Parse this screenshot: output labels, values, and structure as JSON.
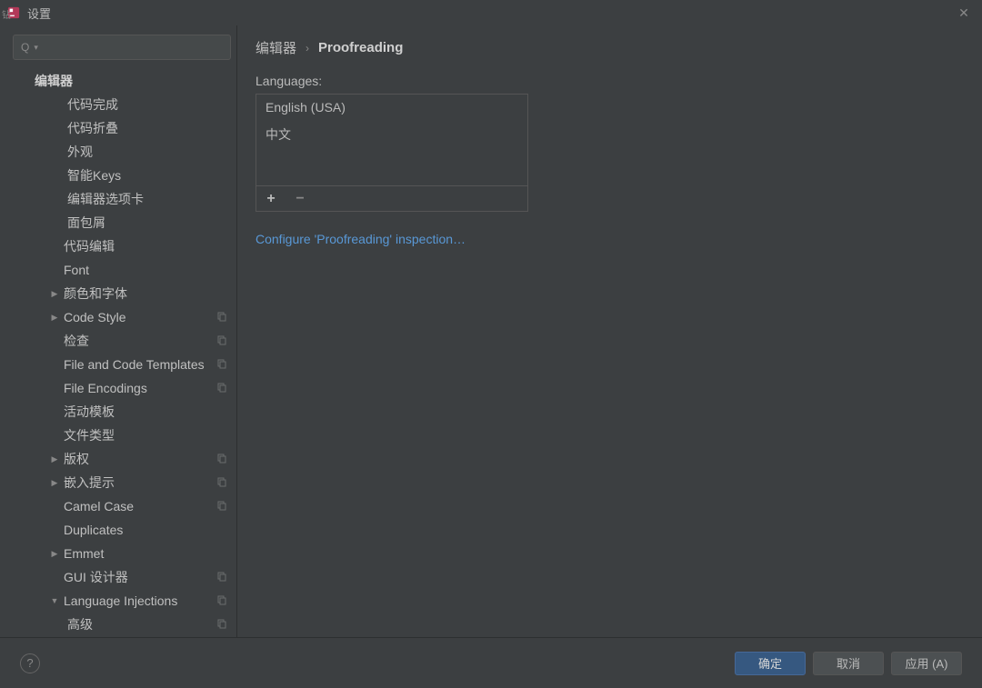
{
  "title": "设置",
  "search": {
    "placeholder": ""
  },
  "sidebar": {
    "section": "编辑器",
    "items": [
      {
        "label": "代码完成",
        "indent": 2,
        "arrow": "",
        "copy": false
      },
      {
        "label": "代码折叠",
        "indent": 2,
        "arrow": "",
        "copy": false
      },
      {
        "label": "外观",
        "indent": 2,
        "arrow": "",
        "copy": false
      },
      {
        "label": "智能Keys",
        "indent": 2,
        "arrow": "▶",
        "copy": false
      },
      {
        "label": "编辑器选项卡",
        "indent": 2,
        "arrow": "",
        "copy": false
      },
      {
        "label": "面包屑",
        "indent": 2,
        "arrow": "",
        "copy": false
      },
      {
        "label": "代码编辑",
        "indent": 1,
        "arrow": "",
        "copy": false
      },
      {
        "label": "Font",
        "indent": 1,
        "arrow": "",
        "copy": false
      },
      {
        "label": "颜色和字体",
        "indent": 1,
        "arrow": "▶",
        "copy": false
      },
      {
        "label": "Code Style",
        "indent": 1,
        "arrow": "▶",
        "copy": true
      },
      {
        "label": "检查",
        "indent": 1,
        "arrow": "",
        "copy": true
      },
      {
        "label": "File and Code Templates",
        "indent": 1,
        "arrow": "",
        "copy": true
      },
      {
        "label": "File Encodings",
        "indent": 1,
        "arrow": "",
        "copy": true
      },
      {
        "label": "活动模板",
        "indent": 1,
        "arrow": "",
        "copy": false
      },
      {
        "label": "文件类型",
        "indent": 1,
        "arrow": "",
        "copy": false
      },
      {
        "label": "版权",
        "indent": 1,
        "arrow": "▶",
        "copy": true
      },
      {
        "label": "嵌入提示",
        "indent": 1,
        "arrow": "▶",
        "copy": true
      },
      {
        "label": "Camel Case",
        "indent": 1,
        "arrow": "",
        "copy": true
      },
      {
        "label": "Duplicates",
        "indent": 1,
        "arrow": "",
        "copy": false
      },
      {
        "label": "Emmet",
        "indent": 1,
        "arrow": "▶",
        "copy": false
      },
      {
        "label": "GUI 设计器",
        "indent": 1,
        "arrow": "",
        "copy": true
      },
      {
        "label": "Language Injections",
        "indent": 1,
        "arrow": "▼",
        "copy": true
      },
      {
        "label": "高级",
        "indent": 2,
        "arrow": "",
        "copy": true
      }
    ]
  },
  "breadcrumb": {
    "parent": "编辑器",
    "current": "Proofreading"
  },
  "panel": {
    "languages_label": "Languages:",
    "languages": [
      "English (USA)",
      "中文"
    ],
    "add_icon": "+",
    "remove_icon": "−",
    "configure_link": "Configure 'Proofreading' inspection…"
  },
  "footer": {
    "help_icon": "?",
    "ok": "确定",
    "cancel": "取消",
    "apply": "应用 (A)"
  }
}
